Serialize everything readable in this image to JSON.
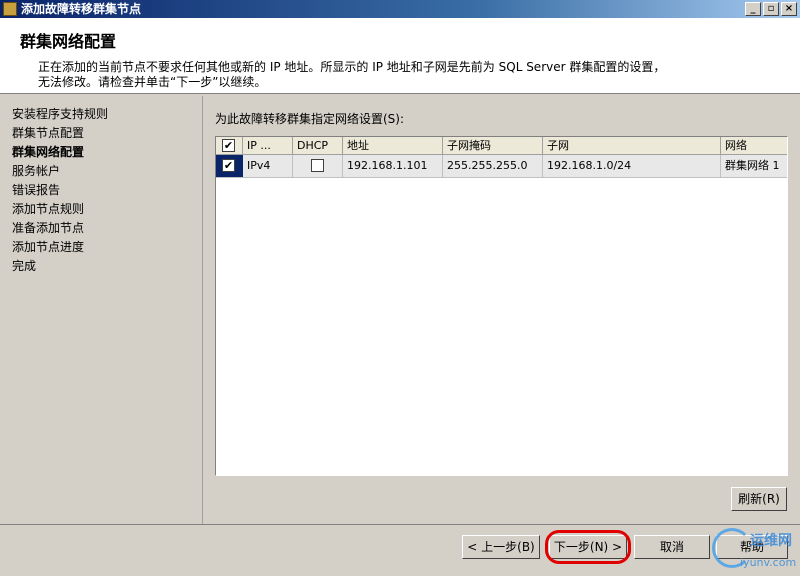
{
  "window": {
    "title": "添加故障转移群集节点",
    "controls": {
      "minimize": "_",
      "restore": "▫",
      "close": "×"
    }
  },
  "header": {
    "title": "群集网络配置",
    "desc_line1": "正在添加的当前节点不要求任何其他或新的 IP 地址。所显示的 IP 地址和子网是先前为 SQL Server 群集配置的设置，",
    "desc_line2": "无法修改。请检查并单击“下一步”以继续。"
  },
  "sidebar": {
    "items": [
      {
        "label": "安装程序支持规则"
      },
      {
        "label": "群集节点配置"
      },
      {
        "label": "群集网络配置"
      },
      {
        "label": "服务帐户"
      },
      {
        "label": "错误报告"
      },
      {
        "label": "添加节点规则"
      },
      {
        "label": "准备添加节点"
      },
      {
        "label": "添加节点进度"
      },
      {
        "label": "完成"
      }
    ]
  },
  "main": {
    "grid_label": "为此故障转移群集指定网络设置(S):",
    "columns": [
      "IP ...",
      "DHCP",
      "地址",
      "子网掩码",
      "子网",
      "网络"
    ],
    "rows": [
      {
        "ip": "IPv4",
        "address": "192.168.1.101",
        "mask": "255.255.255.0",
        "subnet": "192.168.1.0/24",
        "network": "群集网络 1",
        "selected": true,
        "dhcp": false
      }
    ],
    "refresh_label": "刷新(R)"
  },
  "footer": {
    "back_label": "< 上一步(B)",
    "next_label": "下一步(N) >",
    "cancel_label": "取消",
    "help_label": "帮助"
  },
  "watermark": {
    "text_a": "运维网",
    "text_b": "iyunv.com"
  },
  "colors": {
    "titlebar": "#0a246a",
    "highlight": "#e00000",
    "selection": "#0a246a"
  }
}
